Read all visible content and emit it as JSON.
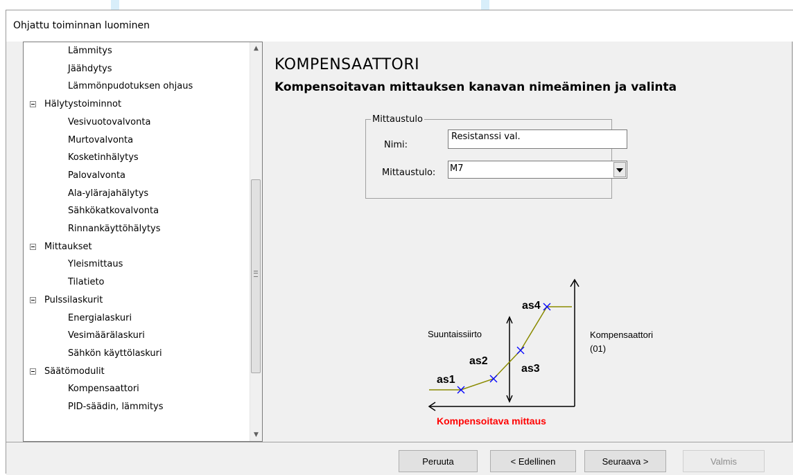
{
  "window": {
    "title": "Ohjattu toiminnan luominen"
  },
  "tree": {
    "items": [
      {
        "label": "Lämmitys",
        "level": 1
      },
      {
        "label": "Jäähdytys",
        "level": 1
      },
      {
        "label": "Lämmönpudotuksen ohjaus",
        "level": 1
      },
      {
        "label": "Hälytystoiminnot",
        "level": 0,
        "expanded": true
      },
      {
        "label": "Vesivuotovalvonta",
        "level": 1
      },
      {
        "label": "Murtovalvonta",
        "level": 1
      },
      {
        "label": "Kosketinhälytys",
        "level": 1
      },
      {
        "label": "Palovalvonta",
        "level": 1
      },
      {
        "label": "Ala-ylärajahälytys",
        "level": 1
      },
      {
        "label": "Sähkökatkovalvonta",
        "level": 1
      },
      {
        "label": "Rinnankäyttöhälytys",
        "level": 1
      },
      {
        "label": "Mittaukset",
        "level": 0,
        "expanded": true
      },
      {
        "label": "Yleismittaus",
        "level": 1
      },
      {
        "label": "Tilatieto",
        "level": 1
      },
      {
        "label": "Pulssilaskurit",
        "level": 0,
        "expanded": true
      },
      {
        "label": "Energialaskuri",
        "level": 1
      },
      {
        "label": "Vesimäärälaskuri",
        "level": 1
      },
      {
        "label": "Sähkön käyttölaskuri",
        "level": 1
      },
      {
        "label": "Säätömodulit",
        "level": 0,
        "expanded": true
      },
      {
        "label": "Kompensaattori",
        "level": 1
      },
      {
        "label": "PID-säädin, lämmitys",
        "level": 1
      }
    ]
  },
  "content": {
    "heading": "KOMPENSAATTORI",
    "subheading": "Kompensoitavan mittauksen kanavan nimeäminen ja valinta",
    "group": {
      "label": "Mittaustulo",
      "name_label": "Nimi:",
      "name_value": "Resistanssi val.",
      "measure_label": "Mittaustulo:",
      "measure_value": "M7"
    },
    "diagram": {
      "offset_label": "Suuntaissiirto",
      "compensator_label_1": "Kompensaattori",
      "compensator_label_2": "(01)",
      "measure_label": "Kompensoitava mittaus",
      "measure_label_color": "#ff0000",
      "curve_color": "#8a8a00",
      "point_color": "#0000ff",
      "points": [
        "as1",
        "as2",
        "as3",
        "as4"
      ]
    }
  },
  "buttons": {
    "cancel": "Peruuta",
    "previous": "< Edellinen",
    "next": "Seuraava >",
    "finish": "Valmis"
  }
}
